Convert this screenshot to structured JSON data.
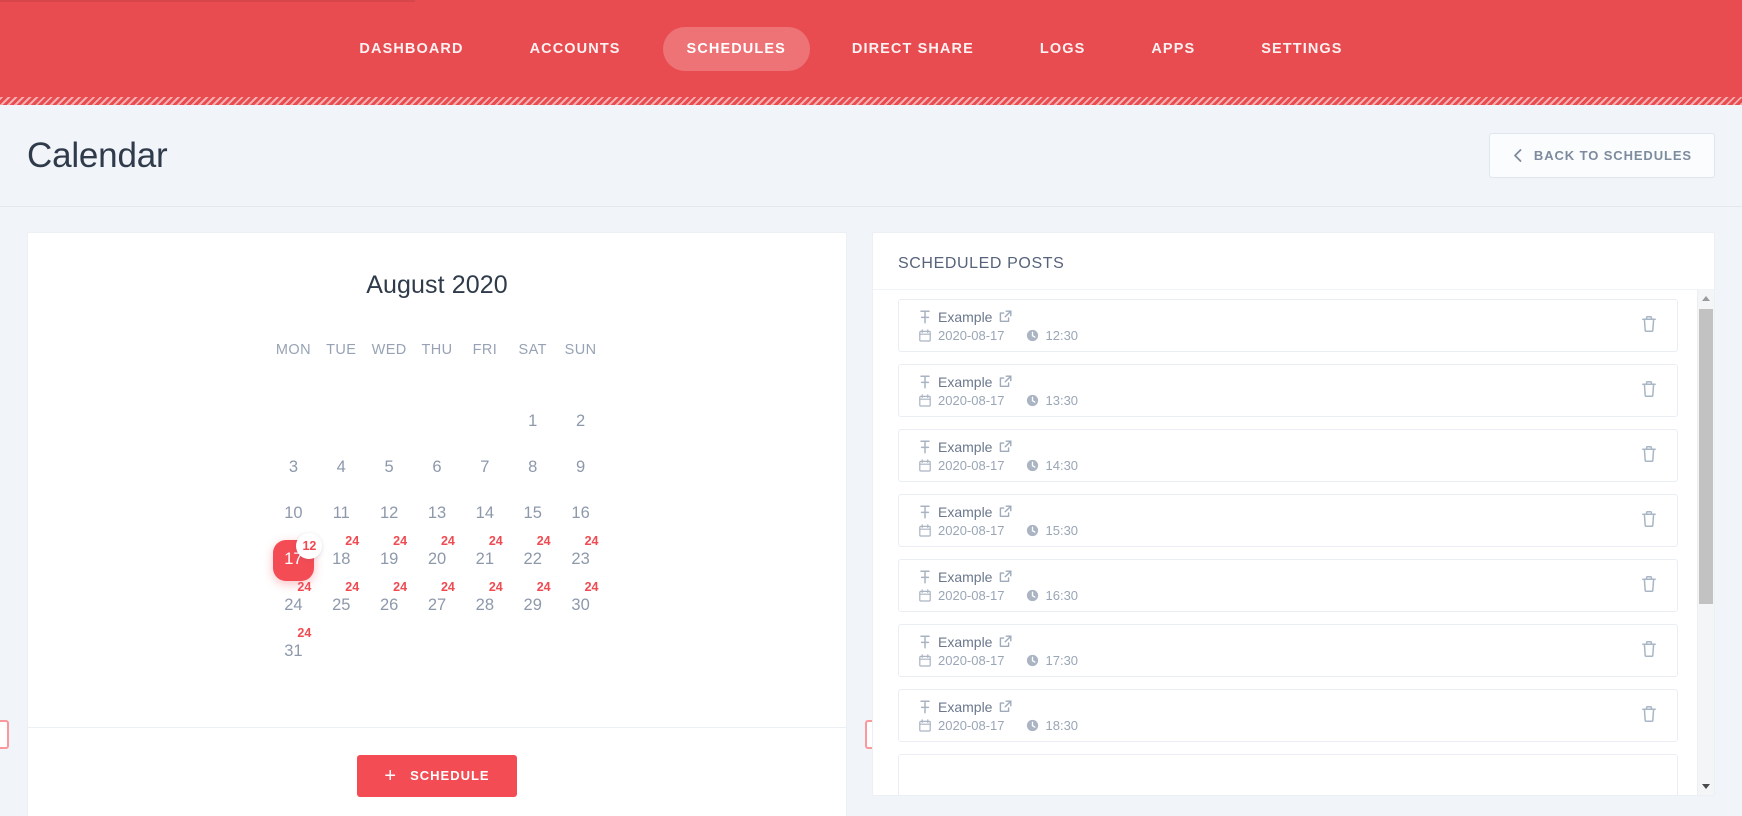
{
  "nav": {
    "items": [
      {
        "label": "DASHBOARD",
        "active": false
      },
      {
        "label": "ACCOUNTS",
        "active": false
      },
      {
        "label": "SCHEDULES",
        "active": true
      },
      {
        "label": "DIRECT SHARE",
        "active": false
      },
      {
        "label": "LOGS",
        "active": false
      },
      {
        "label": "APPS",
        "active": false
      },
      {
        "label": "SETTINGS",
        "active": false
      }
    ],
    "brand_color": "#e84c50"
  },
  "page": {
    "title": "Calendar",
    "back_button": {
      "label": "BACK TO SCHEDULES",
      "icon": "chevron-left-icon"
    }
  },
  "calendar": {
    "month_label": "August 2020",
    "weekdays": [
      "MON",
      "TUE",
      "WED",
      "THU",
      "FRI",
      "SAT",
      "SUN"
    ],
    "prev_icon": "chevron-left-icon",
    "next_icon": "chevron-right-icon",
    "selected_day": 17,
    "accent_color": "#f44c55",
    "leading_blanks": 5,
    "days": [
      {
        "n": 1,
        "count": null
      },
      {
        "n": 2,
        "count": null
      },
      {
        "n": 3,
        "count": null
      },
      {
        "n": 4,
        "count": null
      },
      {
        "n": 5,
        "count": null
      },
      {
        "n": 6,
        "count": null
      },
      {
        "n": 7,
        "count": null
      },
      {
        "n": 8,
        "count": null
      },
      {
        "n": 9,
        "count": null
      },
      {
        "n": 10,
        "count": null
      },
      {
        "n": 11,
        "count": null
      },
      {
        "n": 12,
        "count": null
      },
      {
        "n": 13,
        "count": null
      },
      {
        "n": 14,
        "count": null
      },
      {
        "n": 15,
        "count": null
      },
      {
        "n": 16,
        "count": null
      },
      {
        "n": 17,
        "count": "12",
        "selected": true
      },
      {
        "n": 18,
        "count": "24"
      },
      {
        "n": 19,
        "count": "24"
      },
      {
        "n": 20,
        "count": "24"
      },
      {
        "n": 21,
        "count": "24"
      },
      {
        "n": 22,
        "count": "24"
      },
      {
        "n": 23,
        "count": "24"
      },
      {
        "n": 24,
        "count": "24"
      },
      {
        "n": 25,
        "count": "24"
      },
      {
        "n": 26,
        "count": "24"
      },
      {
        "n": 27,
        "count": "24"
      },
      {
        "n": 28,
        "count": "24"
      },
      {
        "n": 29,
        "count": "24"
      },
      {
        "n": 30,
        "count": "24"
      },
      {
        "n": 31,
        "count": "24"
      }
    ],
    "schedule_button": {
      "label": "SCHEDULE",
      "icon": "plus-icon"
    }
  },
  "scheduled_posts": {
    "title": "SCHEDULED POSTS",
    "row_icons": {
      "pin": "pin-icon",
      "open": "external-link-icon",
      "date": "calendar-icon",
      "time": "clock-icon",
      "delete": "trash-icon"
    },
    "items": [
      {
        "name": "Example",
        "date": "2020-08-17",
        "time": "12:30"
      },
      {
        "name": "Example",
        "date": "2020-08-17",
        "time": "13:30"
      },
      {
        "name": "Example",
        "date": "2020-08-17",
        "time": "14:30"
      },
      {
        "name": "Example",
        "date": "2020-08-17",
        "time": "15:30"
      },
      {
        "name": "Example",
        "date": "2020-08-17",
        "time": "16:30"
      },
      {
        "name": "Example",
        "date": "2020-08-17",
        "time": "17:30"
      },
      {
        "name": "Example",
        "date": "2020-08-17",
        "time": "18:30"
      },
      {
        "name": "",
        "date": "",
        "time": ""
      }
    ]
  }
}
